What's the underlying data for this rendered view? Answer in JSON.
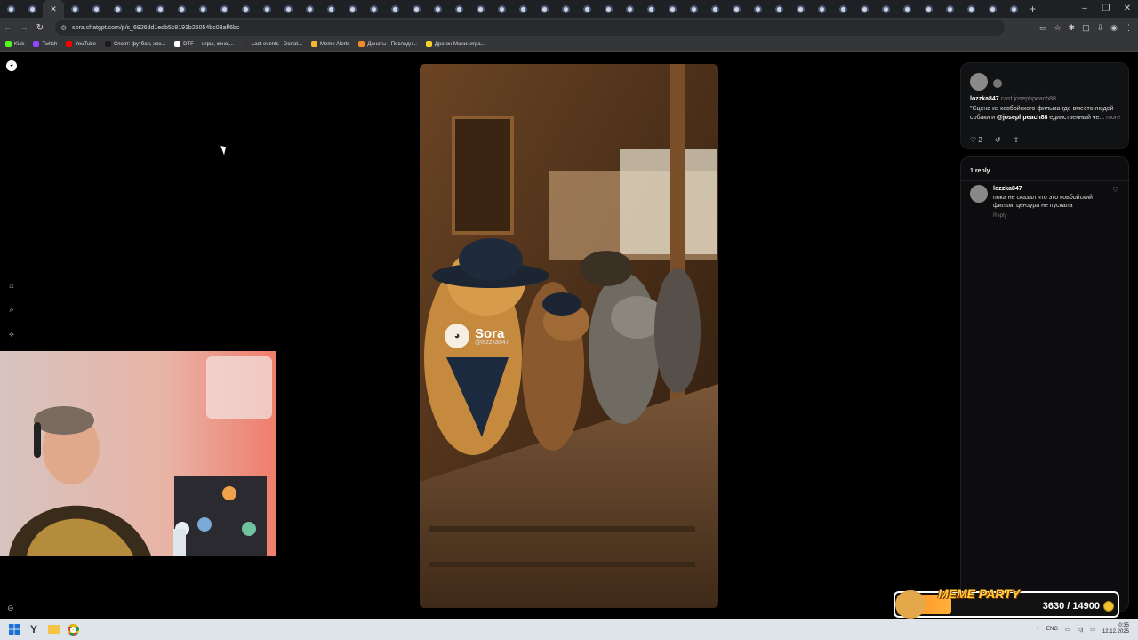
{
  "browser": {
    "tab_count": 48,
    "url": "sora.chatgpt.com/p/s_6926dd1edb5c8191b25054bc03aff6bc",
    "bookmarks": [
      {
        "label": "Kick",
        "color": "#53fc18"
      },
      {
        "label": "Twitch",
        "color": "#9146ff"
      },
      {
        "label": "YouTube",
        "color": "#ff0000"
      },
      {
        "label": "Спорт: футбол, хок...",
        "color": "#1a1a1a"
      },
      {
        "label": "DTF — игры, кино,...",
        "color": "#ffffff"
      },
      {
        "label": "Last events - Donat...",
        "color": "#333333"
      },
      {
        "label": "Meme Alerts",
        "color": "#f5b82e"
      },
      {
        "label": "Донаты - Последн...",
        "color": "#f08a24"
      },
      {
        "label": "Драгон Мани: игра...",
        "color": "#f5d02e"
      }
    ]
  },
  "post": {
    "username": "lozzka847",
    "cast_label": "cast",
    "cast_user": "josephpeach88",
    "caption_start": "\"Сцена из ковбойского фильма где вместо людей собаки и ",
    "caption_mention": "@josephpeach88",
    "caption_end": " единственный че...",
    "more_label": "more",
    "like_count": "2"
  },
  "video": {
    "watermark_title": "Sora",
    "watermark_handle": "@lozzka847"
  },
  "replies": {
    "header": "1 reply",
    "items": [
      {
        "name": "lozzka847",
        "text": "пока не сказал что это ковбойский фильм, цензура не пускала",
        "reply_label": "Reply"
      }
    ]
  },
  "meme_party": {
    "title": "MEME PARTY",
    "count": "3630 / 14900",
    "progress": 0.2436
  },
  "taskbar": {
    "lang": "ENG",
    "time": "0:35",
    "date": "12.12.2025"
  }
}
